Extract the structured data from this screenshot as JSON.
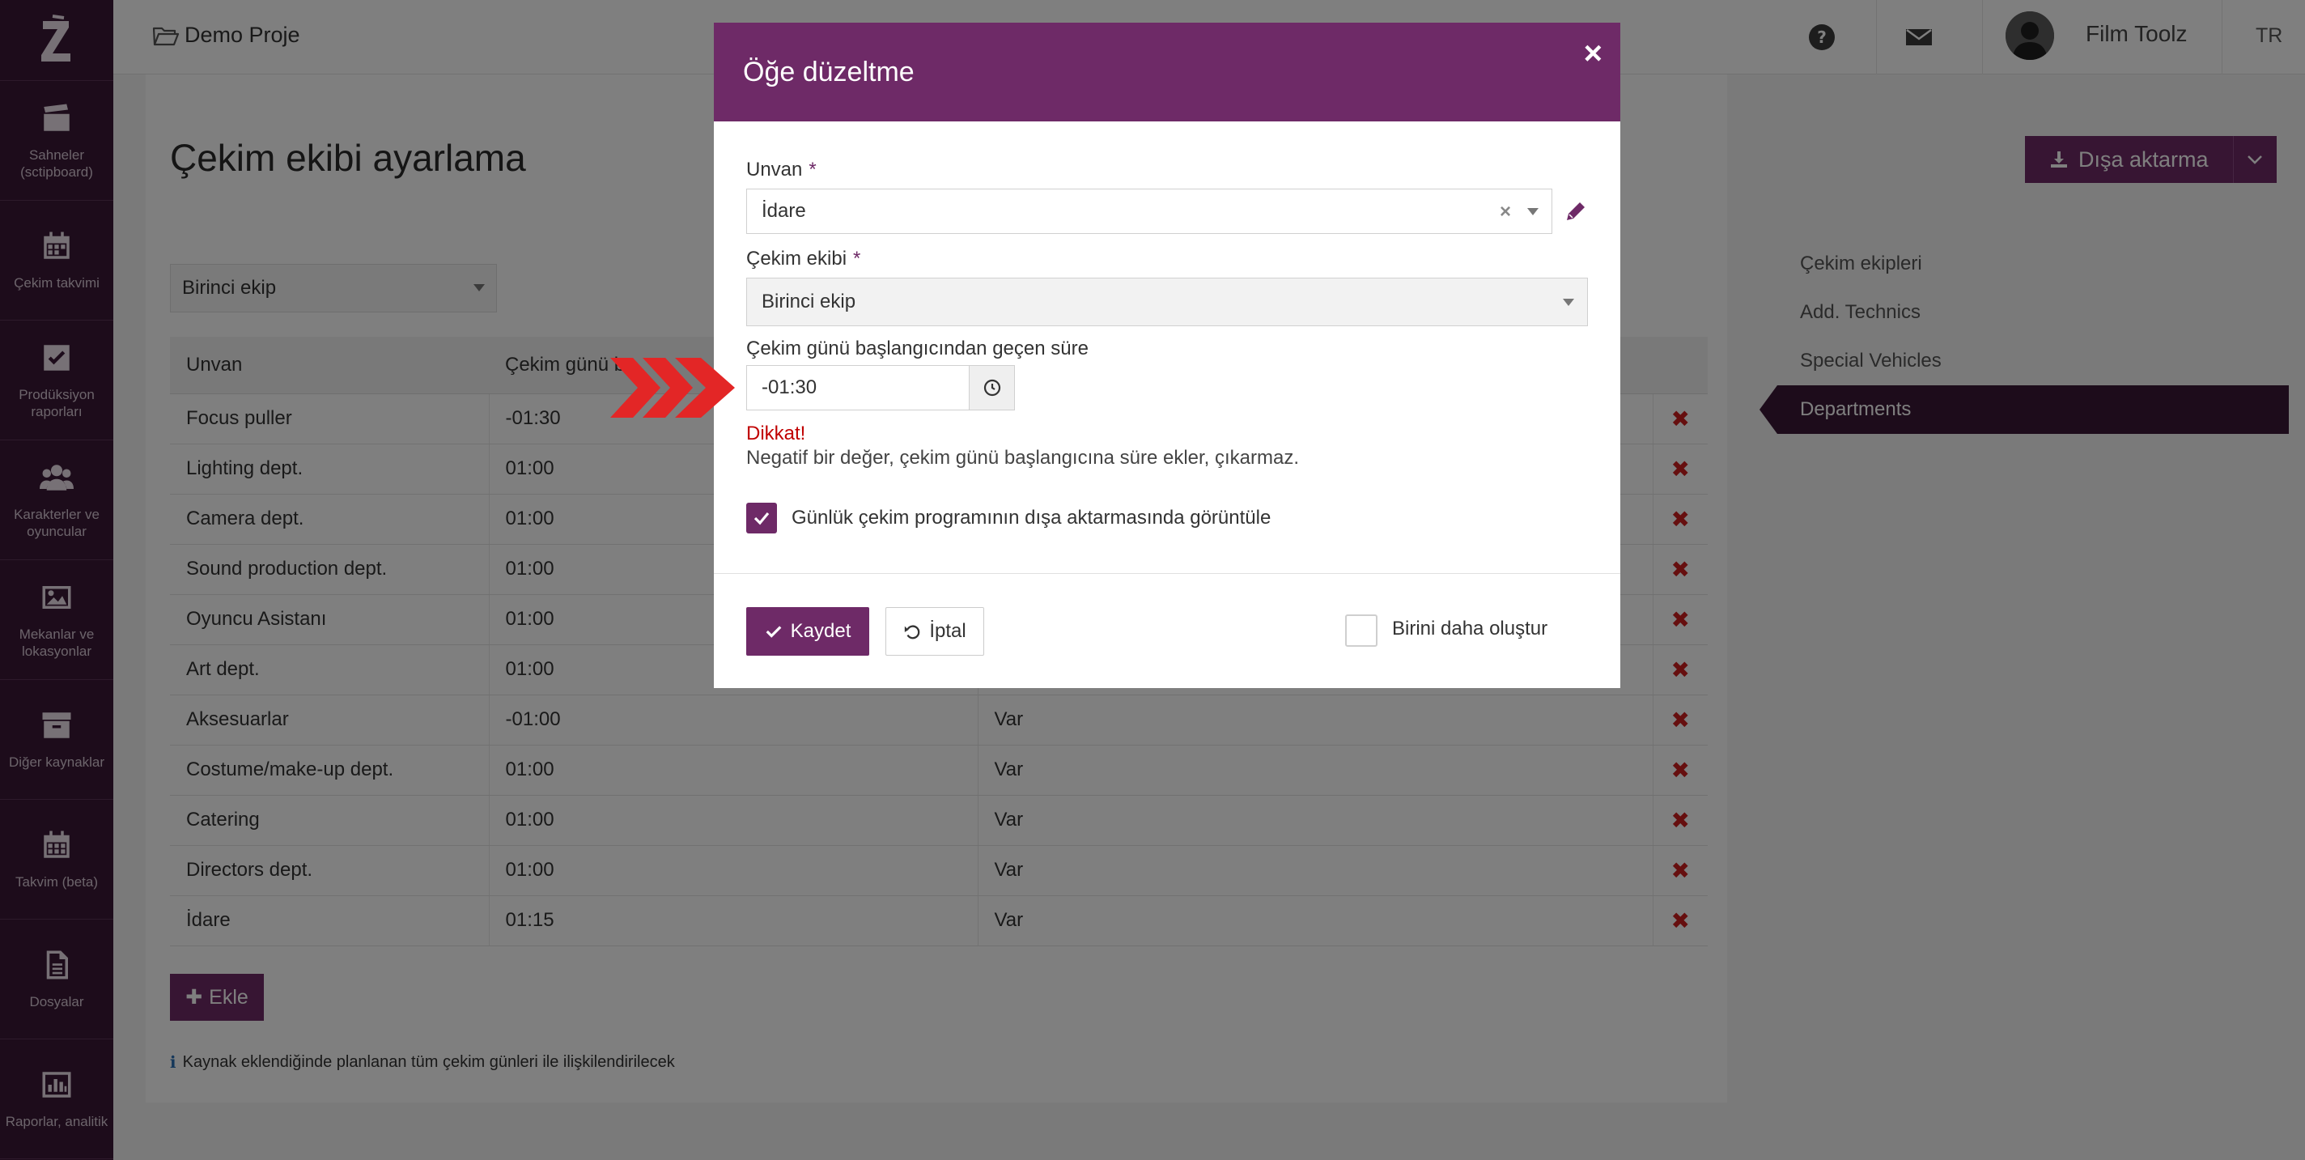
{
  "sidebar": {
    "items": [
      {
        "label": "Sahneler (sctipboard)",
        "icon": "clapperboard-icon"
      },
      {
        "label": "Çekim takvimi",
        "icon": "calendar-icon"
      },
      {
        "label": "Prodüksiyon raporları",
        "icon": "checkbox-icon"
      },
      {
        "label": "Karakterler ve oyuncular",
        "icon": "users-icon"
      },
      {
        "label": "Mekanlar ve lokasyonlar",
        "icon": "image-icon"
      },
      {
        "label": "Diğer kaynaklar",
        "icon": "archive-icon"
      },
      {
        "label": "Takvim (beta)",
        "icon": "calendar-grid-icon"
      },
      {
        "label": "Dosyalar",
        "icon": "file-icon"
      },
      {
        "label": "Raporlar, analitik",
        "icon": "bar-chart-icon"
      }
    ]
  },
  "topbar": {
    "project": "Demo Proje",
    "user_name": "Film Toolz",
    "lang": "TR"
  },
  "page": {
    "title": "Çekim ekibi ayarlama",
    "export_label": "Dışa aktarma",
    "crew_filter": "Birinci ekip",
    "add_label": "Ekle",
    "info_note": "Kaynak eklendiğinde planlanan tüm çekim günleri ile ilişkilendirilecek"
  },
  "table": {
    "headers": [
      "Unvan",
      "Çekim günü b"
    ],
    "rows": [
      [
        "Focus puller",
        "-01:30",
        ""
      ],
      [
        "Lighting dept.",
        "01:00",
        ""
      ],
      [
        "Camera dept.",
        "01:00",
        ""
      ],
      [
        "Sound production dept.",
        "01:00",
        ""
      ],
      [
        "Oyuncu Asistanı",
        "01:00",
        ""
      ],
      [
        "Art dept.",
        "01:00",
        ""
      ],
      [
        "Aksesuarlar",
        "-01:00",
        "Var"
      ],
      [
        "Costume/make-up dept.",
        "01:00",
        "Var"
      ],
      [
        "Catering",
        "01:00",
        "Var"
      ],
      [
        "Directors dept.",
        "01:00",
        "Var"
      ],
      [
        "İdare",
        "01:15",
        "Var"
      ]
    ]
  },
  "right_nav": {
    "items": [
      "Çekim ekipleri",
      "Add. Technics",
      "Special Vehicles",
      "Departments"
    ],
    "active": "Departments"
  },
  "modal": {
    "title": "Öğe düzeltme",
    "unvan_label": "Unvan",
    "unvan_value": "İdare",
    "crew_label": "Çekim ekibi",
    "crew_value": "Birinci ekip",
    "time_label": "Çekim günü başlangıcından geçen süre",
    "time_value": "-01:30",
    "warn_title": "Dikkat!",
    "warn_text": "Negatif bir değer, çekim günü başlangıcına süre ekler, çıkarmaz.",
    "show_label": "Günlük çekim programının dışa aktarmasında görüntüle",
    "show_checked": true,
    "save_label": "Kaydet",
    "cancel_label": "İptal",
    "create_another_label": "Birini daha oluştur",
    "create_another_checked": false
  },
  "colors": {
    "brand": "#6e2a67",
    "sidebar": "#3a1836",
    "danger": "#cc1f1f",
    "pointer": "#e32626"
  }
}
